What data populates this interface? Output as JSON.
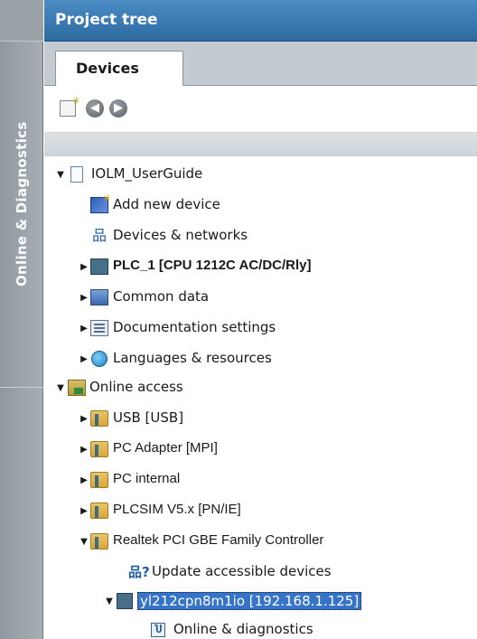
{
  "side_tab": {
    "label": "Online & Diagnostics"
  },
  "header": {
    "title": "Project tree"
  },
  "tabs": [
    {
      "label": "Devices"
    }
  ],
  "toolbar": {
    "new_icon": "new-document-icon",
    "back_icon": "back-arrow-icon",
    "forward_icon": "forward-arrow-icon"
  },
  "tree": {
    "project": "IOLM_UserGuide",
    "add_new_device": "Add new device",
    "devices_networks": "Devices & networks",
    "plc": "PLC_1 [CPU 1212C AC/DC/Rly]",
    "common_data": "Common data",
    "documentation_settings": "Documentation settings",
    "languages_resources": "Languages & resources",
    "online_access": "Online access",
    "usb": "USB [USB]",
    "pc_adapter": "PC Adapter [MPI]",
    "pc_internal": "PC internal",
    "plcsim": "PLCSIM V5.x [PN/IE]",
    "realtek": "Realtek PCI GBE Family Controller",
    "update_devices": "Update accessible devices",
    "device_node": "yl212cpn8m1io [192.168.1.125]",
    "online_diag": "Online & diagnostics"
  },
  "colors": {
    "header_blue": "#2d6aa2",
    "selection_blue": "#3574c9",
    "side_strip_gray": "#9aa2a8"
  }
}
